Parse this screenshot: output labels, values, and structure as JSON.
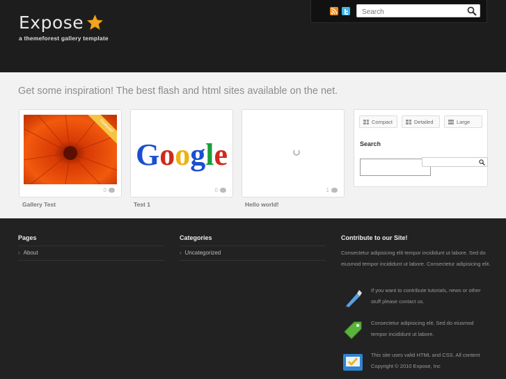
{
  "header": {
    "logo_title": "Expose",
    "logo_subtitle": "a themeforest gallery template",
    "search_placeholder": "Search",
    "icons": [
      "rss-icon",
      "twitter-icon",
      "search-icon"
    ]
  },
  "main": {
    "tagline": "Get some inspiration! The best flash and html sites available on the net.",
    "cards": [
      {
        "title": "Gallery Test",
        "comments": "0",
        "ribbon": "Featured",
        "image": "red-flower"
      },
      {
        "title": "Test 1",
        "comments": "0",
        "image": "google-logo"
      },
      {
        "title": "Hello world!",
        "comments": "1",
        "image": "loading"
      }
    ],
    "views": {
      "compact": "Compact",
      "detailed": "Detailed",
      "large": "Large"
    },
    "search_heading": "Search",
    "google_text": "Google"
  },
  "footer": {
    "pages_heading": "Pages",
    "pages": [
      "About"
    ],
    "categories_heading": "Categories",
    "categories": [
      "Uncategorized"
    ],
    "contribute_heading": "Contribute to our Site!",
    "contribute_intro": "Consectetur adipisicing elit tempor incididunt ut labore. Sed do eiusmod tempor incididunt ut labore. Consectetur adipisicing elit.",
    "items": [
      {
        "icon": "pen-icon",
        "text": "If you want to contribute tutorials, news or other stuff please contact us."
      },
      {
        "icon": "tag-icon",
        "text": "Consectetur adipisicing elit. Sed do eiusmod tempor incididunt ut labore."
      },
      {
        "icon": "validation-icon",
        "text": "This site uses valid HTML and CSS. All content Copyright © 2010 Expose, Inc"
      }
    ]
  },
  "colors": {
    "header_bg": "#1d1d1d",
    "main_bg": "#f2f2f2",
    "footer_bg": "#222222",
    "star": "#f2a51f"
  }
}
